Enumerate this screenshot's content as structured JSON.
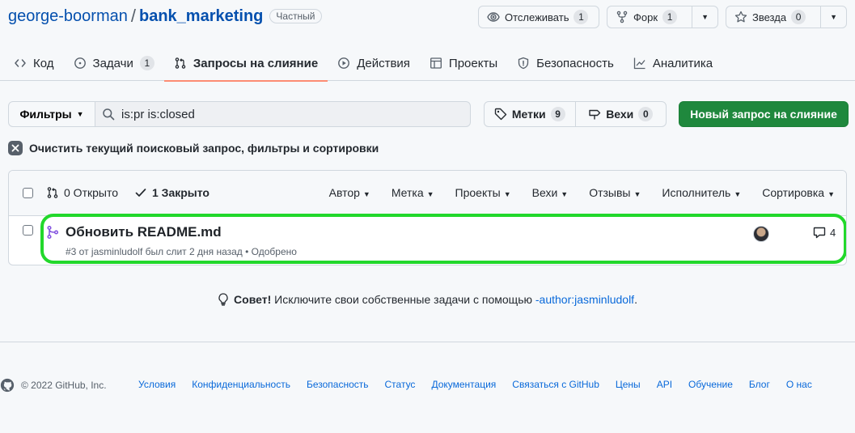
{
  "repo": {
    "owner": "george-boorman",
    "slash": "/",
    "name": "bank_marketing",
    "visibility": "Частный"
  },
  "actions": {
    "watch": {
      "label": "Отслеживать",
      "count": "1"
    },
    "fork": {
      "label": "Форк",
      "count": "1"
    },
    "star": {
      "label": "Звезда",
      "count": "0"
    }
  },
  "tabs": [
    {
      "label": "Код",
      "icon": "code-icon"
    },
    {
      "label": "Задачи",
      "icon": "issue-icon",
      "count": "1"
    },
    {
      "label": "Запросы на слияние",
      "icon": "pull-request-icon",
      "active": true
    },
    {
      "label": "Действия",
      "icon": "play-icon"
    },
    {
      "label": "Проекты",
      "icon": "table-icon"
    },
    {
      "label": "Безопасность",
      "icon": "shield-icon"
    },
    {
      "label": "Аналитика",
      "icon": "graph-icon"
    }
  ],
  "toolbar": {
    "filters_label": "Фильтры",
    "search_value": "is:pr is:closed",
    "labels": {
      "label": "Метки",
      "count": "9"
    },
    "milestones": {
      "label": "Вехи",
      "count": "0"
    },
    "new_pr_label": "Новый запрос на слияние"
  },
  "clear_filters": "Очистить текущий поисковый запрос, фильтры и сортировки",
  "list_header": {
    "open": "0 Открыто",
    "closed": "1 Закрыто",
    "sorters": [
      "Автор",
      "Метка",
      "Проекты",
      "Вехи",
      "Отзывы",
      "Исполнитель",
      "Сортировка"
    ]
  },
  "pull_requests": [
    {
      "title": "Обновить README.md",
      "meta": "#3 от jasminludolf был слит 2 дня назад • Одобрено",
      "comments": "4"
    }
  ],
  "tip": {
    "strong": "Совет!",
    "text": "Исключите свои собственные задачи с помощью",
    "link": "-author:jasminludolf",
    "end": "."
  },
  "footer": {
    "copyright": "© 2022 GitHub, Inc.",
    "links": [
      "Условия",
      "Конфиденциальность",
      "Безопасность",
      "Статус",
      "Документация",
      "Связаться с GitHub",
      "Цены",
      "API",
      "Обучение",
      "Блог",
      "О нас"
    ]
  },
  "colors": {
    "primary_button": "#1f883d",
    "link": "#0969da",
    "merged": "#8250df",
    "highlight": "#22d82b",
    "active_tab": "#fd8c73"
  }
}
